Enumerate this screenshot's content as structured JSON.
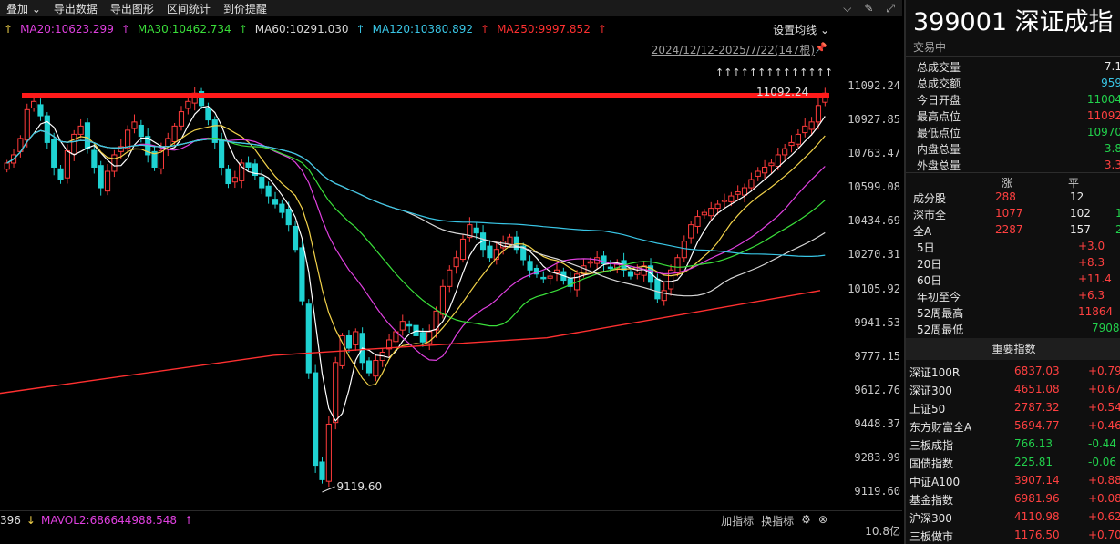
{
  "toolbar": {
    "items": [
      "叠加",
      "导出数据",
      "导出图形",
      "区间统计",
      "到价提醒"
    ]
  },
  "ma_legend": [
    {
      "label": "MA20:10623.299",
      "color": "#e040e0"
    },
    {
      "label": "MA30:10462.734",
      "color": "#3adf3a"
    },
    {
      "label": "MA60:10291.030",
      "color": "#d8d8d8"
    },
    {
      "label": "MA120:10380.892",
      "color": "#39c6e6"
    },
    {
      "label": "MA250:9997.852",
      "color": "#ff3030"
    }
  ],
  "set_ma_label": "设置均线",
  "date_range": "2024/12/12-2025/7/22(147根)",
  "price_axis": [
    "11092.24",
    "10927.85",
    "10763.47",
    "10599.08",
    "10434.69",
    "10270.31",
    "10105.92",
    "9941.53",
    "9777.15",
    "9612.76",
    "9448.37",
    "9283.99",
    "9119.60"
  ],
  "annotations": {
    "low_label": "9119.60",
    "high_label": "11092.24"
  },
  "volume": {
    "left_value": "396",
    "mavol2": "MAVOL2:686644988.548",
    "add_indicator": "加指标",
    "switch_indicator": "换指标",
    "scale": "10.8亿"
  },
  "panel": {
    "code": "399001",
    "name": "深证成指",
    "status": "交易中",
    "stats": [
      {
        "k": "总成交量",
        "v": "7.1",
        "c": "white"
      },
      {
        "k": "总成交额",
        "v": "959",
        "c": "cyan"
      },
      {
        "k": "今日开盘",
        "v": "11004",
        "c": "green"
      },
      {
        "k": "最高点位",
        "v": "11092",
        "c": "red"
      },
      {
        "k": "最低点位",
        "v": "10970",
        "c": "green"
      },
      {
        "k": "内盘总量",
        "v": "3.8",
        "c": "green"
      },
      {
        "k": "外盘总量",
        "v": "3.3",
        "c": "red"
      }
    ],
    "breadth_header": {
      "up": "涨",
      "flat": "平"
    },
    "breadth": [
      {
        "k": "成分股",
        "up": "288",
        "flat": "12",
        "down": ""
      },
      {
        "k": "深市全",
        "up": "1077",
        "flat": "102",
        "down": "1"
      },
      {
        "k": "全A",
        "up": "2287",
        "flat": "157",
        "down": "2"
      }
    ],
    "performance": [
      {
        "k": "5日",
        "v": "+3.0"
      },
      {
        "k": "20日",
        "v": "+8.3"
      },
      {
        "k": "60日",
        "v": "+11.4"
      },
      {
        "k": "年初至今",
        "v": "+6.3"
      },
      {
        "k": "52周最高",
        "v": "11864"
      },
      {
        "k": "52周最低",
        "v": "7908"
      }
    ],
    "index_header": "重要指数",
    "indices": [
      {
        "name": "深证100R",
        "price": "6837.03",
        "chg": "+0.79"
      },
      {
        "name": "深证300",
        "price": "4651.08",
        "chg": "+0.67"
      },
      {
        "name": "上证50",
        "price": "2787.32",
        "chg": "+0.54"
      },
      {
        "name": "东方财富全A",
        "price": "5694.77",
        "chg": "+0.46"
      },
      {
        "name": "三板成指",
        "price": "766.13",
        "chg": "-0.44"
      },
      {
        "name": "国债指数",
        "price": "225.81",
        "chg": "-0.06"
      },
      {
        "name": "中证A100",
        "price": "3907.14",
        "chg": "+0.88"
      },
      {
        "name": "基金指数",
        "price": "6981.96",
        "chg": "+0.08"
      },
      {
        "name": "沪深300",
        "price": "4110.98",
        "chg": "+0.62"
      },
      {
        "name": "三板做市",
        "price": "1176.50",
        "chg": "+0.70"
      }
    ]
  },
  "chart_data": {
    "type": "candlestick",
    "ylim": [
      9119.6,
      11092.24
    ],
    "closes": [
      10720,
      10760,
      10840,
      10980,
      11020,
      10950,
      10820,
      10700,
      10640,
      10780,
      10860,
      10900,
      10790,
      10700,
      10600,
      10680,
      10760,
      10800,
      10880,
      10920,
      10850,
      10760,
      10700,
      10780,
      10840,
      10900,
      10970,
      11020,
      11060,
      11000,
      10930,
      10820,
      10700,
      10620,
      10650,
      10720,
      10700,
      10660,
      10600,
      10560,
      10520,
      10480,
      10420,
      10300,
      10050,
      9700,
      9250,
      9180,
      9450,
      9750,
      9880,
      9820,
      9900,
      9750,
      9700,
      9760,
      9800,
      9860,
      9900,
      9950,
      9930,
      9880,
      9850,
      9900,
      10000,
      10120,
      10200,
      10260,
      10350,
      10420,
      10380,
      10300,
      10260,
      10300,
      10340,
      10360,
      10300,
      10250,
      10200,
      10180,
      10160,
      10170,
      10200,
      10150,
      10120,
      10180,
      10220,
      10240,
      10260,
      10230,
      10210,
      10230,
      10200,
      10170,
      10190,
      10220,
      10140,
      10060,
      10100,
      10200,
      10260,
      10340,
      10420,
      10460,
      10480,
      10500,
      10520,
      10540,
      10560,
      10580,
      10600,
      10640,
      10680,
      10700,
      10720,
      10760,
      10790,
      10820,
      10860,
      10900,
      10920,
      11000,
      11060
    ]
  }
}
